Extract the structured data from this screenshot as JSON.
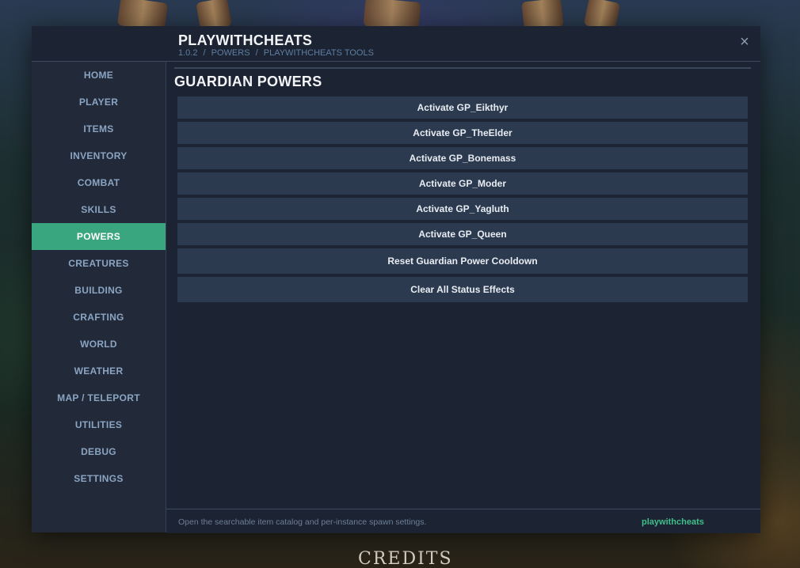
{
  "app": {
    "title": "PLAYWITHCHEATS",
    "close_symbol": "×",
    "breadcrumb": [
      "1.0.2",
      "/",
      "POWERS",
      "/",
      "PLAYWITHCHEATS TOOLS"
    ]
  },
  "background": {
    "credits_text": "CREDITS"
  },
  "sidebar": {
    "active": "POWERS",
    "items": [
      {
        "label": "HOME"
      },
      {
        "label": "PLAYER"
      },
      {
        "label": "ITEMS"
      },
      {
        "label": "INVENTORY"
      },
      {
        "label": "COMBAT"
      },
      {
        "label": "SKILLS"
      },
      {
        "label": "POWERS"
      },
      {
        "label": "CREATURES"
      },
      {
        "label": "BUILDING"
      },
      {
        "label": "CRAFTING"
      },
      {
        "label": "WORLD"
      },
      {
        "label": "WEATHER"
      },
      {
        "label": "MAP / TELEPORT"
      },
      {
        "label": "UTILITIES"
      },
      {
        "label": "DEBUG"
      },
      {
        "label": "SETTINGS"
      }
    ]
  },
  "main": {
    "title": "GUARDIAN POWERS",
    "actions": [
      {
        "label": "Activate GP_Eikthyr"
      },
      {
        "label": "Activate GP_TheElder"
      },
      {
        "label": "Activate GP_Bonemass"
      },
      {
        "label": "Activate GP_Moder"
      },
      {
        "label": "Activate GP_Yagluth"
      },
      {
        "label": "Activate GP_Queen"
      },
      {
        "label": "Reset Guardian Power Cooldown"
      },
      {
        "label": "Clear All Status Effects"
      }
    ]
  },
  "footer": {
    "hint": "Open the searchable item catalog and per-instance spawn settings.",
    "brand": "playwithcheats"
  },
  "colors": {
    "accent": "#3aa680",
    "brand": "#3fbf8a",
    "panel": "#1c2332",
    "sidebar": "#222a3a",
    "button": "#2c3a50"
  }
}
